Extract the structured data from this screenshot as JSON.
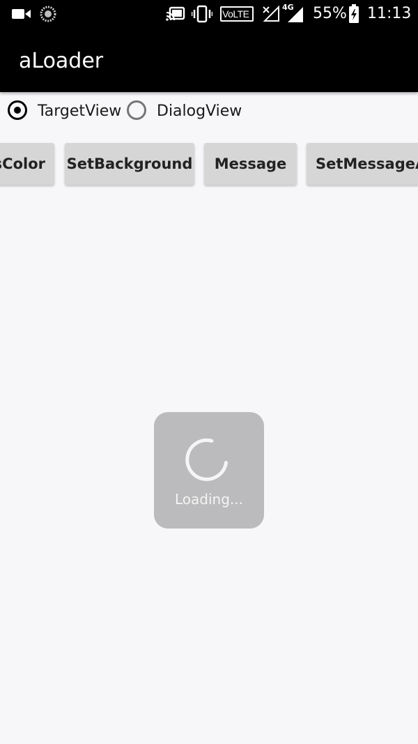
{
  "status_bar": {
    "battery_percent": "55%",
    "time": "11:13",
    "volte_label": "VoLTE",
    "network_label": "4G",
    "icons": [
      "video-camera-icon",
      "sync-icon",
      "cast-icon",
      "vibrate-icon",
      "volte-icon",
      "no-signal-icon",
      "signal-4g-icon",
      "battery-charging-icon"
    ]
  },
  "app_bar": {
    "title": "aLoader"
  },
  "mode_selector": {
    "options": [
      {
        "label": "TargetView",
        "checked": true
      },
      {
        "label": "DialogView",
        "checked": false
      }
    ]
  },
  "buttons": [
    {
      "label": "sColor"
    },
    {
      "label": "SetBackground"
    },
    {
      "label": "Message"
    },
    {
      "label": "SetMessageA"
    }
  ],
  "loader": {
    "message": "Loading..."
  },
  "colors": {
    "app_bar": "#000000",
    "background": "#f7f6f8",
    "button": "#d6d6d6",
    "loader_box": "#bbbabc"
  }
}
